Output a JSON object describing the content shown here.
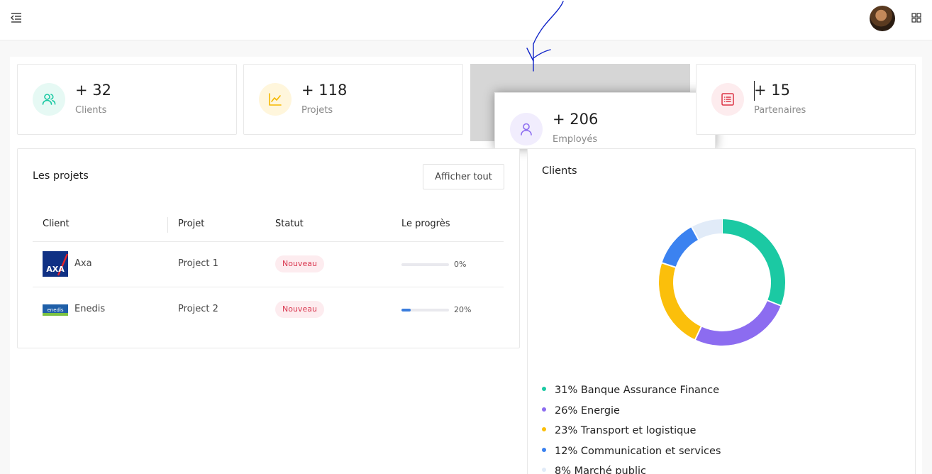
{
  "stats": [
    {
      "value": "+ 32",
      "label": "Clients",
      "icon": "users-icon",
      "color": "#1bc9a3",
      "bg": "#e6f9f4"
    },
    {
      "value": "+ 118",
      "label": "Projets",
      "icon": "chart-line-icon",
      "color": "#f5b800",
      "bg": "#fff6dc"
    },
    {
      "value": "+ 206",
      "label": "Employés",
      "icon": "user-icon",
      "color": "#8c6cf0",
      "bg": "#f1edfd"
    },
    {
      "value": "+ 15",
      "label": "Partenaires",
      "icon": "list-icon",
      "color": "#dc3545",
      "bg": "#fdecee"
    }
  ],
  "projects_panel": {
    "title": "Les projets",
    "show_all_label": "Afficher tout",
    "columns": [
      "Client",
      "Projet",
      "Statut",
      "Le progrès"
    ],
    "rows": [
      {
        "client": "Axa",
        "logo": "axa-logo",
        "project": "Project 1",
        "status": "Nouveau",
        "progress": 0,
        "progress_label": "0%"
      },
      {
        "client": "Enedis",
        "logo": "enedis-logo",
        "project": "Project 2",
        "status": "Nouveau",
        "progress": 20,
        "progress_label": "20%"
      }
    ]
  },
  "clients_panel": {
    "title": "Clients",
    "legend": [
      {
        "label": "31% Banque Assurance Finance",
        "color": "#1bc9a3"
      },
      {
        "label": "26% Energie",
        "color": "#8c6cf0"
      },
      {
        "label": "23% Transport et logistique",
        "color": "#fbbf0b"
      },
      {
        "label": "12% Communication et services",
        "color": "#3b82f0"
      },
      {
        "label": "8% Marché public",
        "color": "#e1ebf8"
      }
    ]
  },
  "chart_data": {
    "type": "pie",
    "categories": [
      "Banque Assurance Finance",
      "Energie",
      "Transport et logistique",
      "Communication et services",
      "Marché public"
    ],
    "values": [
      31,
      26,
      23,
      12,
      8
    ],
    "title": "Clients",
    "colors": [
      "#1bc9a3",
      "#8c6cf0",
      "#fbbf0b",
      "#3b82f0",
      "#e1ebf8"
    ],
    "legend": "bottom"
  }
}
